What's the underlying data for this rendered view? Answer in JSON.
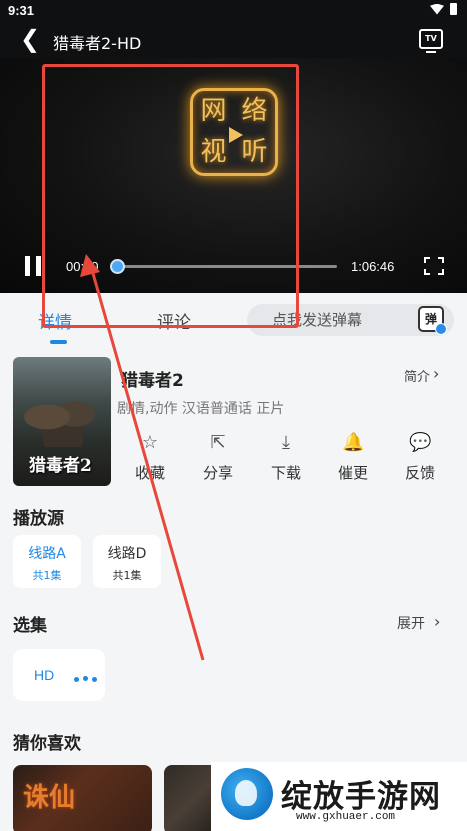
{
  "status": {
    "time": "9:31"
  },
  "header": {
    "back": "❮",
    "title": "猎毒者2-HD",
    "tv": "TV"
  },
  "player": {
    "logo_chars": [
      "网",
      "络",
      "视",
      "听"
    ],
    "current_time": "00:00",
    "total_time": "1:06:46",
    "progress": 0
  },
  "tabs": {
    "detail": "详情",
    "comment": "评论",
    "danmu_placeholder": "点我发送弹幕",
    "danmu_icon": "弹"
  },
  "movie": {
    "poster_title": "猎毒者2",
    "name": "猎毒者2",
    "intro": "简介",
    "meta": "剧情,动作 汉语普通话 正片"
  },
  "actions": [
    {
      "icon": "star-icon",
      "glyph": "☆",
      "label": "收藏"
    },
    {
      "icon": "share-icon",
      "glyph": "⇱",
      "label": "分享"
    },
    {
      "icon": "download-icon",
      "glyph": "⤓",
      "label": "下载"
    },
    {
      "icon": "bell-icon",
      "glyph": "🔔",
      "label": "催更"
    },
    {
      "icon": "feedback-icon",
      "glyph": "💬",
      "label": "反馈"
    }
  ],
  "sources": {
    "title": "播放源",
    "items": [
      {
        "name": "线路A",
        "count": "共1集"
      },
      {
        "name": "线路D",
        "count": "共1集"
      }
    ]
  },
  "episodes": {
    "title": "选集",
    "expand": "展开",
    "items": [
      {
        "label": "HD"
      }
    ]
  },
  "recommend": {
    "title": "猜你喜欢",
    "card1_title": "诛仙"
  },
  "watermark": {
    "text": "绽放手游网",
    "url": "www.gxhuaer.com"
  }
}
